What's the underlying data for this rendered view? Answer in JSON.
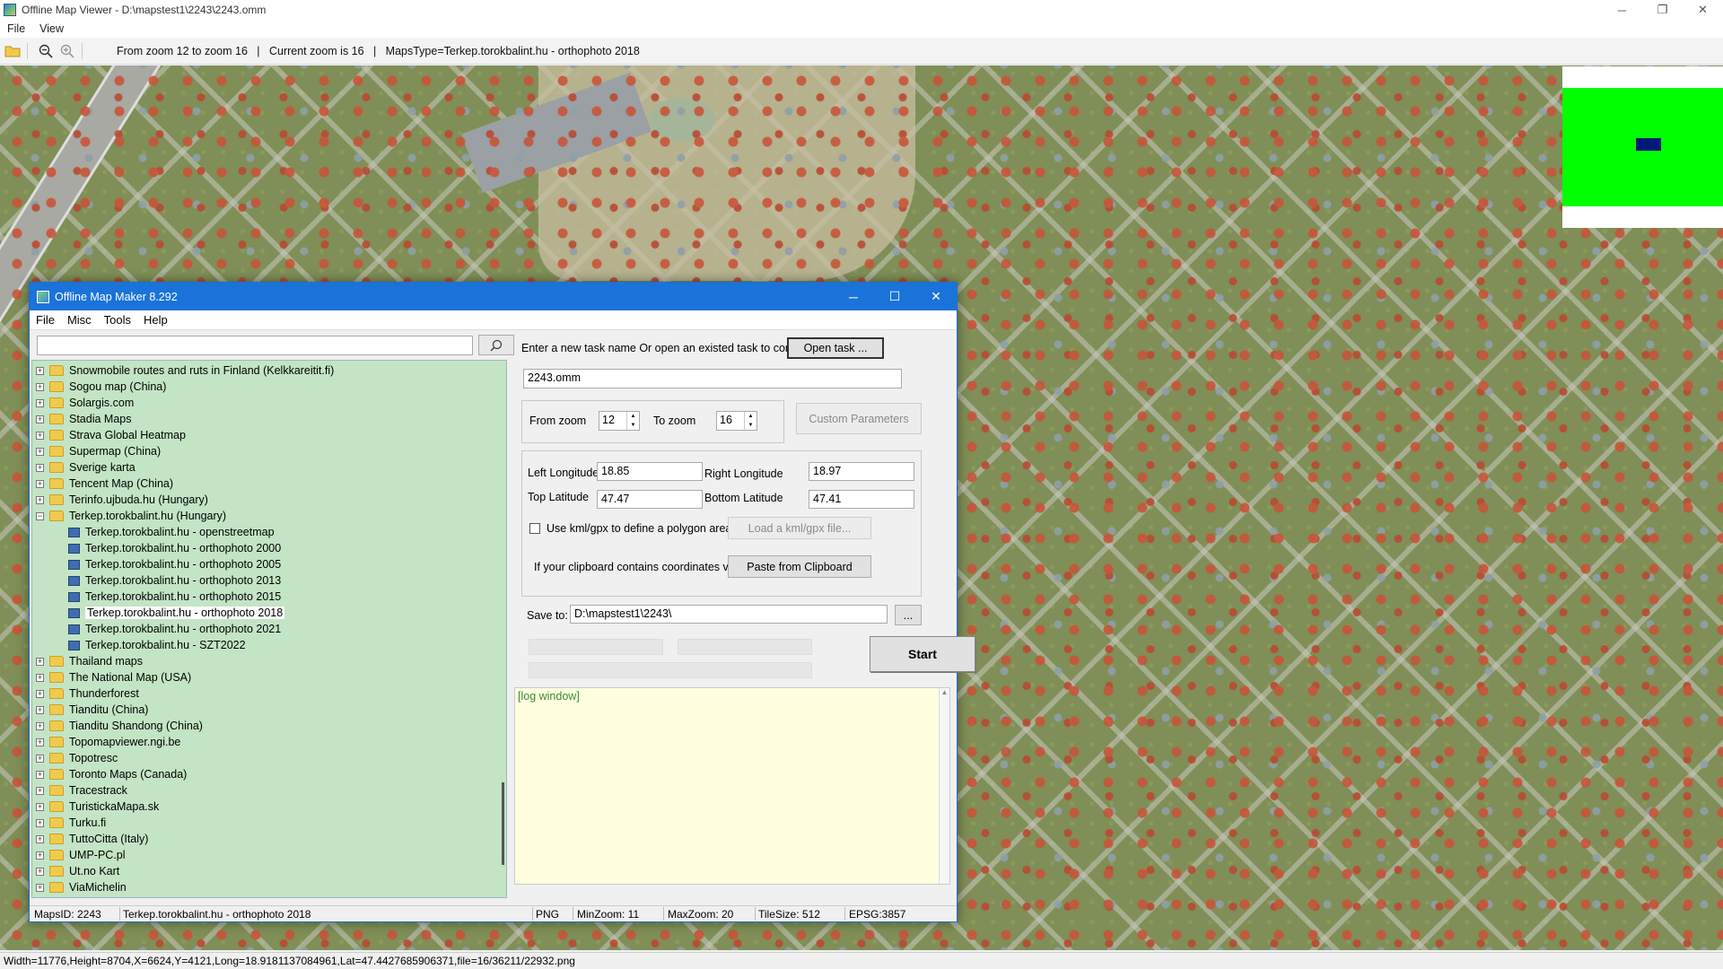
{
  "window": {
    "title": "Offline Map Viewer - D:\\mapstest1\\2243\\2243.omm",
    "controls": [
      "─",
      "❐",
      "✕"
    ]
  },
  "menu": [
    "File",
    "View"
  ],
  "toolbar": {
    "info": "From zoom 12 to zoom 16   |   Current zoom is 16   |   MapsType=Terkep.torokbalint.hu - orthophoto 2018"
  },
  "status": {
    "text": "Width=11776,Height=8704,X=6624,Y=4121,Long=18.9181137084961,Lat=47.4427685906371,file=16/36211/22932.png"
  },
  "dialog": {
    "title": "Offline Map Maker 8.292",
    "controls": [
      "─",
      "☐",
      "✕"
    ],
    "menu": [
      "File",
      "Misc",
      "Tools",
      "Help"
    ],
    "search": {
      "value": "",
      "placeholder": ""
    },
    "tree": [
      {
        "label": "Snowmobile routes and ruts in Finland (Kelkkareitit.fi)",
        "type": "folder"
      },
      {
        "label": "Sogou map (China)",
        "type": "folder"
      },
      {
        "label": "Solargis.com",
        "type": "folder"
      },
      {
        "label": "Stadia Maps",
        "type": "folder"
      },
      {
        "label": "Strava Global Heatmap",
        "type": "folder"
      },
      {
        "label": "Supermap (China)",
        "type": "folder"
      },
      {
        "label": "Sverige karta",
        "type": "folder"
      },
      {
        "label": "Tencent Map (China)",
        "type": "folder"
      },
      {
        "label": "Terinfo.ujbuda.hu (Hungary)",
        "type": "folder"
      },
      {
        "label": "Terkep.torokbalint.hu (Hungary)",
        "type": "folder-open"
      },
      {
        "label": "Terkep.torokbalint.hu - openstreetmap",
        "type": "map"
      },
      {
        "label": "Terkep.torokbalint.hu - orthophoto 2000",
        "type": "map"
      },
      {
        "label": "Terkep.torokbalint.hu - orthophoto 2005",
        "type": "map"
      },
      {
        "label": "Terkep.torokbalint.hu - orthophoto 2013",
        "type": "map"
      },
      {
        "label": "Terkep.torokbalint.hu - orthophoto 2015",
        "type": "map"
      },
      {
        "label": "Terkep.torokbalint.hu - orthophoto 2018",
        "type": "map",
        "selected": true
      },
      {
        "label": "Terkep.torokbalint.hu - orthophoto 2021",
        "type": "map"
      },
      {
        "label": "Terkep.torokbalint.hu - SZT2022",
        "type": "map"
      },
      {
        "label": "Thailand maps",
        "type": "folder"
      },
      {
        "label": "The National Map (USA)",
        "type": "folder"
      },
      {
        "label": "Thunderforest",
        "type": "folder"
      },
      {
        "label": "Tianditu (China)",
        "type": "folder"
      },
      {
        "label": "Tianditu Shandong (China)",
        "type": "folder"
      },
      {
        "label": "Topomapviewer.ngi.be",
        "type": "folder"
      },
      {
        "label": "Topotresc",
        "type": "folder"
      },
      {
        "label": "Toronto Maps (Canada)",
        "type": "folder"
      },
      {
        "label": "Tracestrack",
        "type": "folder"
      },
      {
        "label": "TuristickaMapa.sk",
        "type": "folder"
      },
      {
        "label": "Turku.fi",
        "type": "folder"
      },
      {
        "label": "TuttoCitta (Italy)",
        "type": "folder"
      },
      {
        "label": "UMP-PC.pl",
        "type": "folder"
      },
      {
        "label": "Ut.no Kart",
        "type": "folder"
      },
      {
        "label": "ViaMichelin",
        "type": "folder"
      }
    ],
    "task_prompt": "Enter a new task name Or open an existed task to continue:",
    "open_task_label": "Open task ...",
    "task_name": "2243.omm",
    "from_zoom_label": "From zoom",
    "from_zoom": "12",
    "to_zoom_label": "To zoom",
    "to_zoom": "16",
    "custom_params_label": "Custom Parameters",
    "left_lon_label": "Left Longitude",
    "left_lon": "18.85",
    "right_lon_label": "Right Longitude",
    "right_lon": "18.97",
    "top_lat_label": "Top Latitude",
    "top_lat": "47.47",
    "bottom_lat_label": "Bottom Latitude",
    "bottom_lat": "47.41",
    "kml_label": "Use kml/gpx to define a polygon area",
    "load_kml_label": "Load a kml/gpx file...",
    "clipboard_prompt": "If your clipboard contains coordinates values:",
    "paste_label": "Paste from Clipboard",
    "save_to_label": "Save to:",
    "save_to": "D:\\mapstest1\\2243\\",
    "browse_label": "...",
    "start_label": "Start",
    "log_label": "[log window]",
    "status": {
      "maps_id": "MapsID: 2243",
      "maps_name": "Terkep.torokbalint.hu - orthophoto 2018",
      "format": "PNG",
      "min_zoom": "MinZoom: 11",
      "max_zoom": "MaxZoom: 20",
      "tile_size": "TileSize: 512",
      "epsg": "EPSG:3857"
    }
  },
  "colors": {
    "dialog_title": "#1a73d9",
    "tree_bg": "#c3e4c5",
    "minimap_green": "#00ff00",
    "minimap_viewport": "#001a7a",
    "log_bg": "#ffffe0"
  }
}
